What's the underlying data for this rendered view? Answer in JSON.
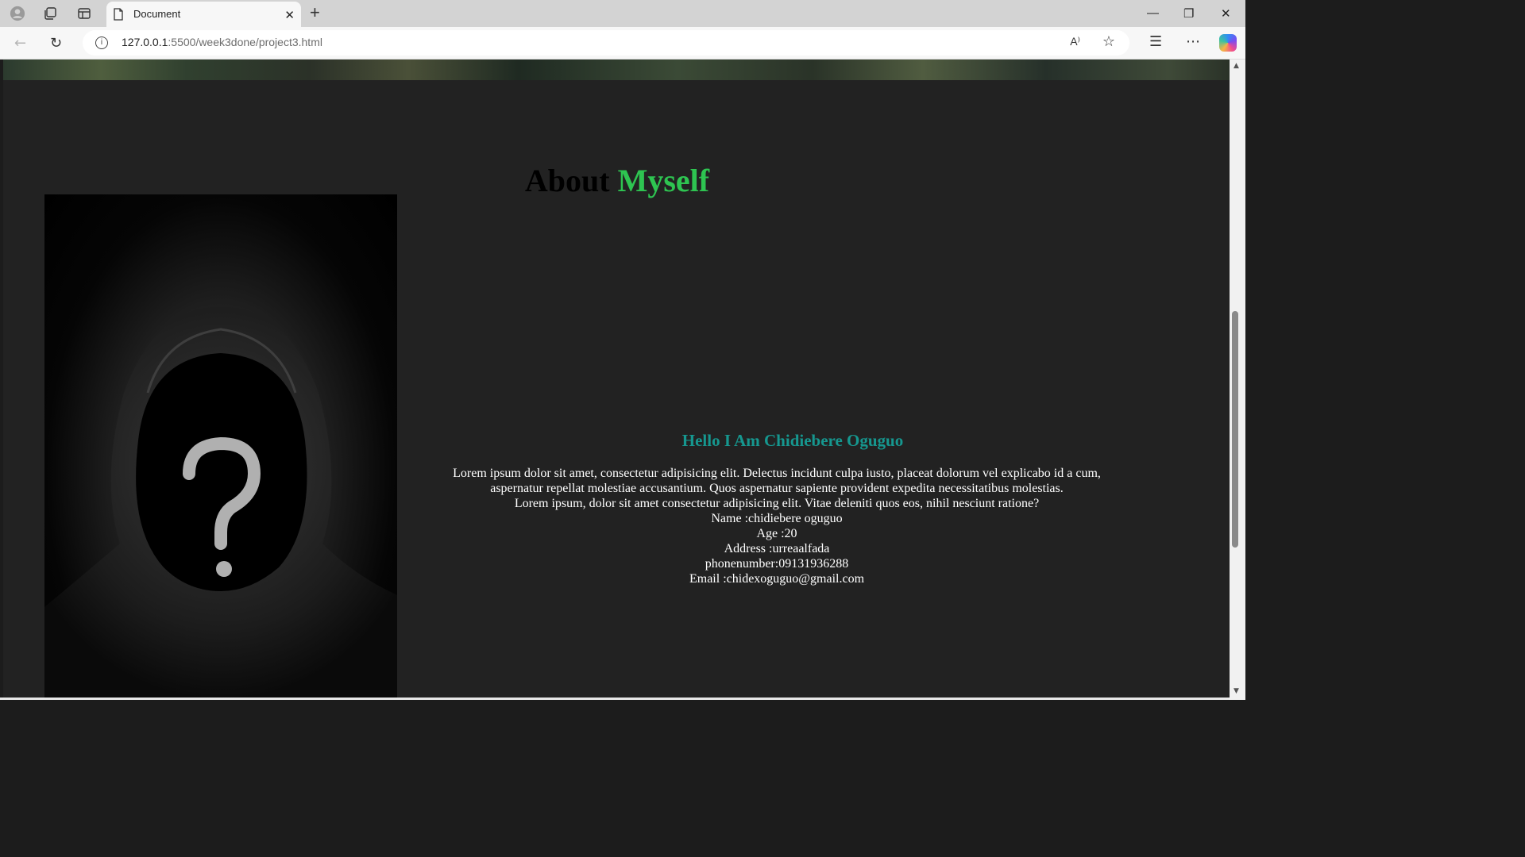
{
  "browser": {
    "tab_title": "Document",
    "new_tab_label": "+",
    "url_host": "127.0.0.1",
    "url_path": ":5500/week3done/project3.html",
    "read_aloud_label": "A⁾",
    "window_controls": {
      "minimize": "—",
      "restore": "❐",
      "close": "✕"
    },
    "icons": [
      "profile-icon",
      "workspaces-icon",
      "tab-actions-icon",
      "document-icon",
      "back-icon",
      "reload-icon",
      "info-icon",
      "favorite-star-icon",
      "favorites-icon",
      "more-icon",
      "copilot-icon"
    ]
  },
  "page": {
    "about_title_part1": "About",
    "about_title_part2": "Myself",
    "hello_heading": "Hello I Am Chidiebere Oguguo",
    "bio_lines": [
      "Lorem ipsum dolor sit amet, consectetur adipisicing elit. Delectus incidunt culpa iusto, placeat dolorum vel explicabo id a cum,",
      "aspernatur repellat molestiae accusantium. Quos aspernatur sapiente provident expedita necessitatibus molestias.",
      "Lorem ipsum, dolor sit amet consectetur adipisicing elit. Vitae deleniti quos eos, nihil nesciunt ratione?",
      "Name :chidiebere oguguo",
      "Age :20",
      "Address :urreaalfada",
      "phonenumber:09131936288",
      "Email :chidexoguguo@gmail.com"
    ],
    "photo_alt": "hooded figure with question mark",
    "colors": {
      "accent_green": "#2ec451",
      "hello_teal": "#16978f",
      "section_bg": "#222222"
    }
  }
}
